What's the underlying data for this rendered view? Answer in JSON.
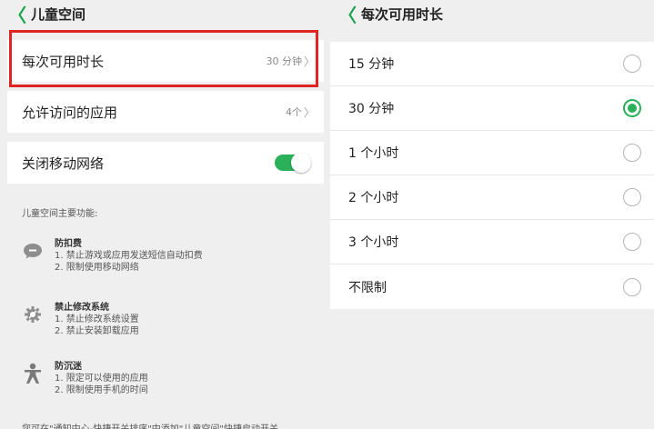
{
  "left": {
    "header": {
      "back_glyph": "〈",
      "title": "儿童空间"
    },
    "rows": {
      "duration": {
        "label": "每次可用时长",
        "value": "30 分钟",
        "chevron": "〉"
      },
      "apps": {
        "label": "允许访问的应用",
        "value": "4个",
        "chevron": "〉"
      },
      "network": {
        "label": "关闭移动网络",
        "toggle_on": true
      }
    },
    "features_heading": "儿童空间主要功能:",
    "features": [
      {
        "icon": "chat-bubble-icon",
        "name": "防扣费",
        "lines": [
          "1. 禁止游戏或应用发送短信自动扣费",
          "2. 限制使用移动网络"
        ]
      },
      {
        "icon": "gear-icon",
        "name": "禁止修改系统",
        "lines": [
          "1. 禁止修改系统设置",
          "2. 禁止安装卸载应用"
        ]
      },
      {
        "icon": "person-icon",
        "name": "防沉迷",
        "lines": [
          "1. 限定可以使用的应用",
          "2. 限制使用手机的时间"
        ]
      }
    ],
    "footer_note": "您可在\"通知中心-快捷开关排序\"中添加\"儿童空间\"快捷启动开关"
  },
  "right": {
    "header": {
      "back_glyph": "〈",
      "title": "每次可用时长"
    },
    "options": [
      {
        "label": "15 分钟",
        "selected": false
      },
      {
        "label": "30 分钟",
        "selected": true
      },
      {
        "label": "1 个小时",
        "selected": false
      },
      {
        "label": "2 个小时",
        "selected": false
      },
      {
        "label": "3 个小时",
        "selected": false
      },
      {
        "label": "不限制",
        "selected": false
      }
    ]
  },
  "colors": {
    "accent": "#2ab15a",
    "highlight_border": "#e02424",
    "background": "#efefef"
  }
}
